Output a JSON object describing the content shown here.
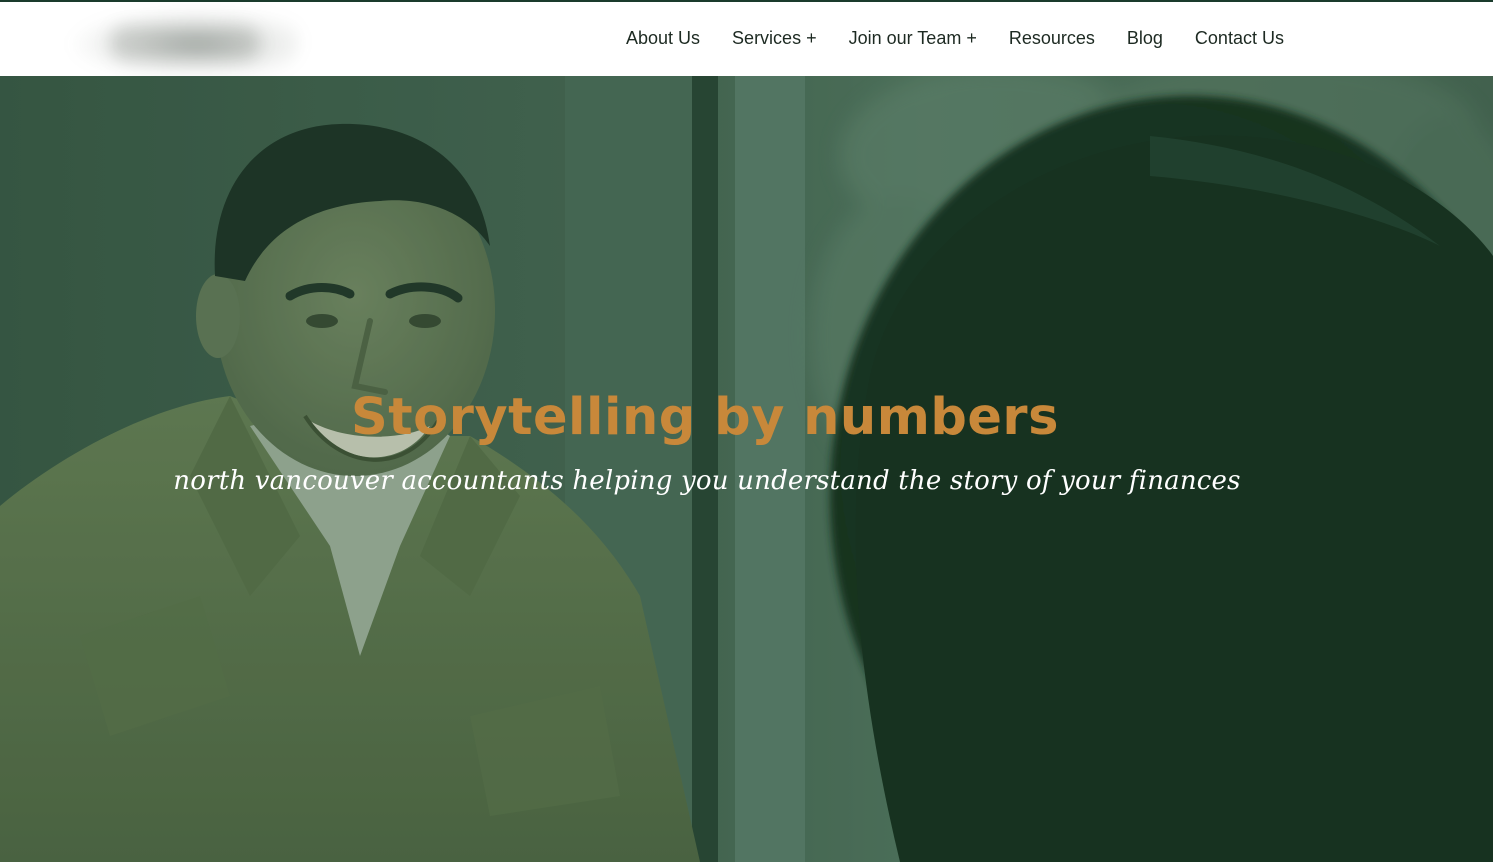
{
  "nav": {
    "items": [
      {
        "label": "About Us",
        "has_submenu": false
      },
      {
        "label": "Services",
        "has_submenu": true
      },
      {
        "label": "Join our Team",
        "has_submenu": true
      },
      {
        "label": "Resources",
        "has_submenu": false
      },
      {
        "label": "Blog",
        "has_submenu": false
      },
      {
        "label": "Contact Us",
        "has_submenu": false
      }
    ],
    "submenu_indicator": "+"
  },
  "hero": {
    "title": "Storytelling by numbers",
    "subtitle": "north vancouver accountants helping you understand the story of your finances"
  },
  "colors": {
    "header_bg": "#ffffff",
    "nav_text": "#1d2a22",
    "hero_tint": "#3e5e4b",
    "title_accent": "#c8883a",
    "subtitle_text": "#ffffff"
  }
}
